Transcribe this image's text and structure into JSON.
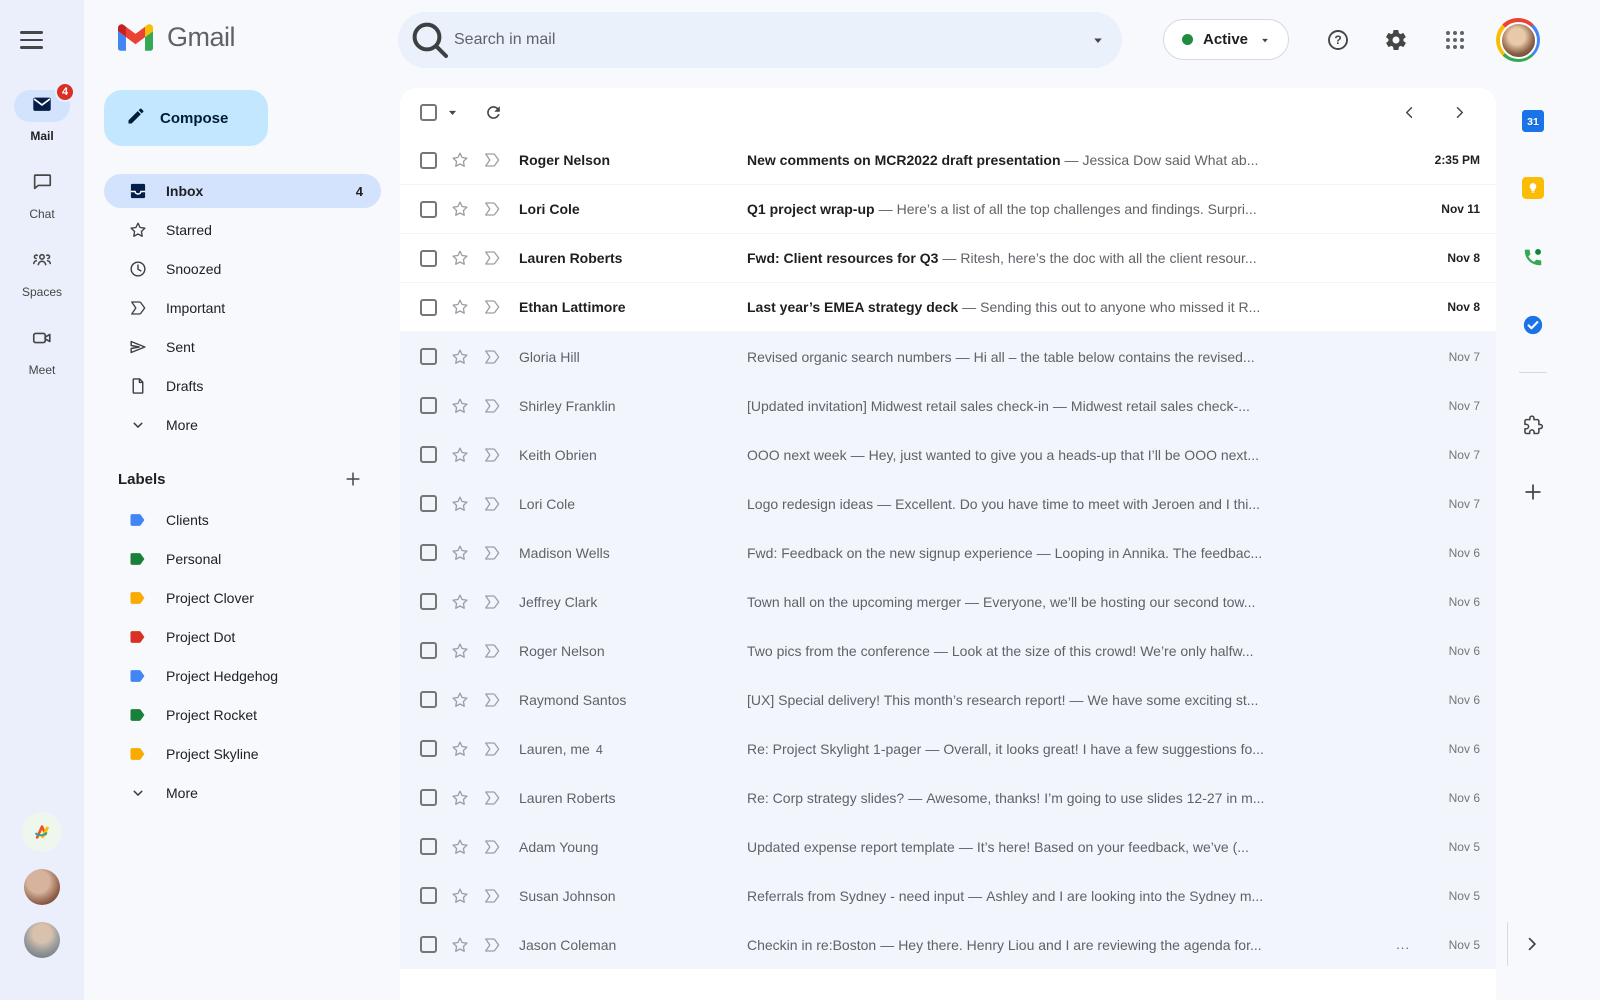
{
  "brand": {
    "app_name": "Gmail"
  },
  "colors": {
    "compose_bg": "#c2e7ff",
    "selected_pill": "#d3e3fd",
    "read_row_bg": "#f2f6fc",
    "badge_red": "#d93025",
    "status_green": "#1e8e3e"
  },
  "rail": {
    "items": [
      {
        "name": "mail",
        "label": "Mail",
        "badge": "4",
        "active": true
      },
      {
        "name": "chat",
        "label": "Chat"
      },
      {
        "name": "spaces",
        "label": "Spaces"
      },
      {
        "name": "meet",
        "label": "Meet"
      }
    ]
  },
  "topbar": {
    "search_placeholder": "Search in mail",
    "status_label": "Active"
  },
  "sidebar": {
    "compose_label": "Compose",
    "items": [
      {
        "label": "Inbox",
        "icon": "inbox",
        "count": "4",
        "active": true
      },
      {
        "label": "Starred",
        "icon": "star"
      },
      {
        "label": "Snoozed",
        "icon": "clock"
      },
      {
        "label": "Important",
        "icon": "important"
      },
      {
        "label": "Sent",
        "icon": "send"
      },
      {
        "label": "Drafts",
        "icon": "draft"
      },
      {
        "label": "More",
        "icon": "chevron-down"
      }
    ],
    "labels_header": "Labels",
    "labels": [
      {
        "label": "Clients",
        "color": "#4285f4"
      },
      {
        "label": "Personal",
        "color": "#188038"
      },
      {
        "label": "Project Clover",
        "color": "#f9ab00"
      },
      {
        "label": "Project Dot",
        "color": "#d93025"
      },
      {
        "label": "Project Hedgehog",
        "color": "#4285f4"
      },
      {
        "label": "Project Rocket",
        "color": "#188038"
      },
      {
        "label": "Project Skyline",
        "color": "#f9ab00"
      }
    ],
    "labels_more": "More"
  },
  "list": {
    "separator": "—",
    "emails": [
      {
        "sender": "Roger Nelson",
        "subject": "New comments on MCR2022 draft presentation",
        "snippet": "Jessica Dow said What ab...",
        "date": "2:35 PM",
        "unread": true
      },
      {
        "sender": "Lori Cole",
        "subject": "Q1 project wrap-up",
        "snippet": "Here’s a list of all the top challenges and findings. Surpri...",
        "date": "Nov 11",
        "unread": true
      },
      {
        "sender": "Lauren Roberts",
        "subject": "Fwd: Client resources for Q3",
        "snippet": "Ritesh, here’s the doc with all the client resour...",
        "date": "Nov 8",
        "unread": true
      },
      {
        "sender": "Ethan Lattimore",
        "subject": "Last year’s EMEA strategy deck",
        "snippet": "Sending this out to anyone who missed it R...",
        "date": "Nov 8",
        "unread": true
      },
      {
        "sender": "Gloria Hill",
        "subject": "Revised organic search numbers",
        "snippet": "Hi all – the table below contains the revised...",
        "date": "Nov 7",
        "unread": false
      },
      {
        "sender": "Shirley Franklin",
        "subject": "[Updated invitation] Midwest retail sales check-in",
        "snippet": "Midwest retail sales check-...",
        "date": "Nov 7",
        "unread": false
      },
      {
        "sender": "Keith Obrien",
        "subject": "OOO next week",
        "snippet": "Hey, just wanted to give you a heads-up that I’ll be OOO next...",
        "date": "Nov 7",
        "unread": false
      },
      {
        "sender": "Lori Cole",
        "subject": "Logo redesign ideas",
        "snippet": "Excellent. Do you have time to meet with Jeroen and I thi...",
        "date": "Nov 7",
        "unread": false
      },
      {
        "sender": "Madison Wells",
        "subject": "Fwd: Feedback on the new signup experience",
        "snippet": "Looping in Annika. The feedbac...",
        "date": "Nov 6",
        "unread": false
      },
      {
        "sender": "Jeffrey Clark",
        "subject": "Town hall on the upcoming merger",
        "snippet": "Everyone, we’ll be hosting our second tow...",
        "date": "Nov 6",
        "unread": false
      },
      {
        "sender": "Roger Nelson",
        "subject": "Two pics from the conference",
        "snippet": "Look at the size of this crowd! We’re only halfw...",
        "date": "Nov 6",
        "unread": false
      },
      {
        "sender": "Raymond Santos",
        "subject": "[UX] Special delivery! This month’s research report!",
        "snippet": "We have some exciting st...",
        "date": "Nov 6",
        "unread": false
      },
      {
        "sender": "Lauren, me",
        "thread_count": "4",
        "subject": "Re: Project Skylight 1-pager",
        "snippet": "Overall, it looks great! I have a few suggestions fo...",
        "date": "Nov 6",
        "unread": false
      },
      {
        "sender": "Lauren Roberts",
        "subject": "Re: Corp strategy slides?",
        "snippet": "Awesome, thanks! I’m going to use slides 12-27 in m...",
        "date": "Nov 6",
        "unread": false
      },
      {
        "sender": "Adam Young",
        "subject": "Updated expense report template",
        "snippet": "It’s here! Based on your feedback, we’ve (...",
        "date": "Nov 5",
        "unread": false
      },
      {
        "sender": "Susan Johnson",
        "subject": "Referrals from Sydney - need input",
        "snippet": "Ashley and I are looking into the Sydney m...",
        "date": "Nov 5",
        "unread": false
      },
      {
        "sender": "Jason Coleman",
        "subject": "Checkin in re:Boston",
        "snippet": "Hey there. Henry Liou and I are reviewing the agenda for...",
        "date": "Nov 5",
        "unread": false,
        "overflow": "..."
      }
    ]
  },
  "right_rail": {
    "icons": [
      "calendar",
      "keep",
      "voice",
      "tasks",
      "addons",
      "add"
    ]
  }
}
